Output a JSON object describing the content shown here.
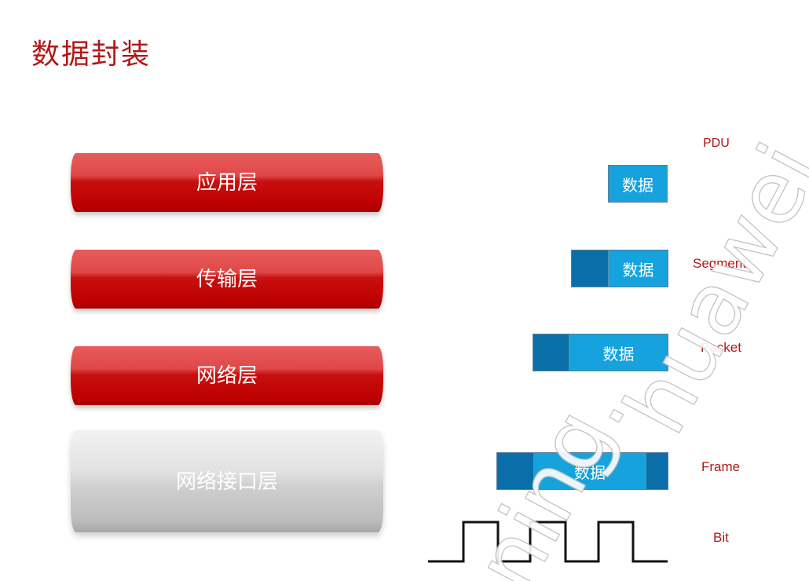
{
  "page": {
    "title": "数据封装"
  },
  "layers": [
    {
      "label": "应用层"
    },
    {
      "label": "传输层"
    },
    {
      "label": "网络层"
    },
    {
      "label": "网络接口层"
    }
  ],
  "pdu": {
    "heading": "PDU",
    "rows": [
      {
        "label": "",
        "data_label": "数据",
        "has_header": false,
        "has_trailer": false
      },
      {
        "label": "Segment",
        "data_label": "数据",
        "has_header": true,
        "has_trailer": false
      },
      {
        "label": "Packet",
        "data_label": "数据",
        "has_header": true,
        "has_trailer": false
      },
      {
        "label": "Frame",
        "data_label": "数据",
        "has_header": true,
        "has_trailer": true
      },
      {
        "label": "Bit"
      }
    ]
  },
  "watermark": {
    "text": "huawei",
    "text2": "ning."
  },
  "colors": {
    "title": "#b01818",
    "layer_red": "#c00000",
    "layer_gray": "#cfcfcf",
    "header_blue": "#0a6ea8",
    "data_blue": "#16a3dd",
    "label_red": "#b01818"
  }
}
